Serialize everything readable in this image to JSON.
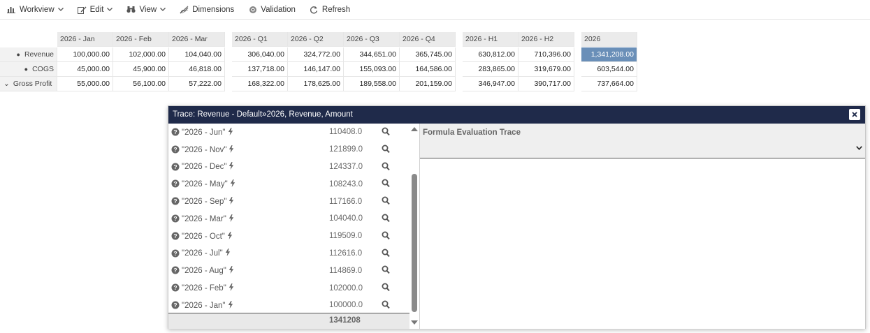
{
  "toolbar": {
    "workview": "Workview",
    "edit": "Edit",
    "view": "View",
    "dimensions": "Dimensions",
    "validation": "Validation",
    "refresh": "Refresh"
  },
  "grid": {
    "headers": [
      "2026 - Jan",
      "2026 - Feb",
      "2026 - Mar",
      "2026 - Q1",
      "2026 - Q2",
      "2026 - Q3",
      "2026 - Q4",
      "2026 - H1",
      "2026 - H2",
      "2026"
    ],
    "rows": [
      {
        "label": "Revenue",
        "marker": "●",
        "values": [
          "100,000.00",
          "102,000.00",
          "104,040.00",
          "306,040.00",
          "324,772.00",
          "344,651.00",
          "365,745.00",
          "630,812.00",
          "710,396.00",
          "1,341,208.00"
        ]
      },
      {
        "label": "COGS",
        "marker": "●",
        "values": [
          "45,000.00",
          "45,900.00",
          "46,818.00",
          "137,718.00",
          "146,147.00",
          "155,093.00",
          "164,586.00",
          "283,865.00",
          "319,679.00",
          "603,544.00"
        ]
      },
      {
        "label": "Gross Profit",
        "marker": "⌄",
        "values": [
          "55,000.00",
          "56,100.00",
          "57,222.00",
          "168,322.00",
          "178,625.00",
          "189,558.00",
          "201,159.00",
          "346,947.00",
          "390,717.00",
          "737,664.00"
        ]
      }
    ],
    "selected_color": "#6a8fb8"
  },
  "trace": {
    "title": "Trace: Revenue - Default»2026, Revenue, Amount",
    "items": [
      {
        "label": "\"2026 - Jun\"",
        "value": "110408.0"
      },
      {
        "label": "\"2026 - Nov\"",
        "value": "121899.0"
      },
      {
        "label": "\"2026 - Dec\"",
        "value": "124337.0"
      },
      {
        "label": "\"2026 - May\"",
        "value": "108243.0"
      },
      {
        "label": "\"2026 - Sep\"",
        "value": "117166.0"
      },
      {
        "label": "\"2026 - Mar\"",
        "value": "104040.0"
      },
      {
        "label": "\"2026 - Oct\"",
        "value": "119509.0"
      },
      {
        "label": "\"2026 - Jul\"",
        "value": "112616.0"
      },
      {
        "label": "\"2026 - Aug\"",
        "value": "114869.0"
      },
      {
        "label": "\"2026 - Feb\"",
        "value": "102000.0"
      },
      {
        "label": "\"2026 - Jan\"",
        "value": "100000.0"
      }
    ],
    "total": "1341208",
    "panel_title": "Formula Evaluation Trace",
    "title_bar_color": "#1f2a4a"
  }
}
